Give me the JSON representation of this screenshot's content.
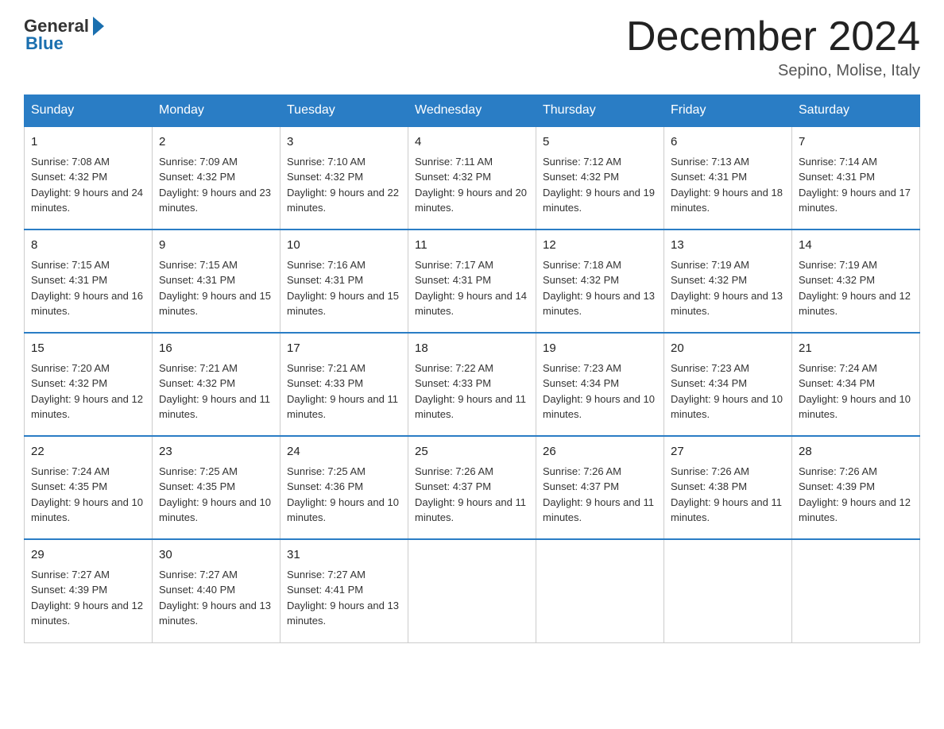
{
  "header": {
    "title": "December 2024",
    "location": "Sepino, Molise, Italy",
    "logo_general": "General",
    "logo_blue": "Blue"
  },
  "weekdays": [
    "Sunday",
    "Monday",
    "Tuesday",
    "Wednesday",
    "Thursday",
    "Friday",
    "Saturday"
  ],
  "weeks": [
    [
      {
        "day": "1",
        "sunrise": "7:08 AM",
        "sunset": "4:32 PM",
        "daylight": "9 hours and 24 minutes."
      },
      {
        "day": "2",
        "sunrise": "7:09 AM",
        "sunset": "4:32 PM",
        "daylight": "9 hours and 23 minutes."
      },
      {
        "day": "3",
        "sunrise": "7:10 AM",
        "sunset": "4:32 PM",
        "daylight": "9 hours and 22 minutes."
      },
      {
        "day": "4",
        "sunrise": "7:11 AM",
        "sunset": "4:32 PM",
        "daylight": "9 hours and 20 minutes."
      },
      {
        "day": "5",
        "sunrise": "7:12 AM",
        "sunset": "4:32 PM",
        "daylight": "9 hours and 19 minutes."
      },
      {
        "day": "6",
        "sunrise": "7:13 AM",
        "sunset": "4:31 PM",
        "daylight": "9 hours and 18 minutes."
      },
      {
        "day": "7",
        "sunrise": "7:14 AM",
        "sunset": "4:31 PM",
        "daylight": "9 hours and 17 minutes."
      }
    ],
    [
      {
        "day": "8",
        "sunrise": "7:15 AM",
        "sunset": "4:31 PM",
        "daylight": "9 hours and 16 minutes."
      },
      {
        "day": "9",
        "sunrise": "7:15 AM",
        "sunset": "4:31 PM",
        "daylight": "9 hours and 15 minutes."
      },
      {
        "day": "10",
        "sunrise": "7:16 AM",
        "sunset": "4:31 PM",
        "daylight": "9 hours and 15 minutes."
      },
      {
        "day": "11",
        "sunrise": "7:17 AM",
        "sunset": "4:31 PM",
        "daylight": "9 hours and 14 minutes."
      },
      {
        "day": "12",
        "sunrise": "7:18 AM",
        "sunset": "4:32 PM",
        "daylight": "9 hours and 13 minutes."
      },
      {
        "day": "13",
        "sunrise": "7:19 AM",
        "sunset": "4:32 PM",
        "daylight": "9 hours and 13 minutes."
      },
      {
        "day": "14",
        "sunrise": "7:19 AM",
        "sunset": "4:32 PM",
        "daylight": "9 hours and 12 minutes."
      }
    ],
    [
      {
        "day": "15",
        "sunrise": "7:20 AM",
        "sunset": "4:32 PM",
        "daylight": "9 hours and 12 minutes."
      },
      {
        "day": "16",
        "sunrise": "7:21 AM",
        "sunset": "4:32 PM",
        "daylight": "9 hours and 11 minutes."
      },
      {
        "day": "17",
        "sunrise": "7:21 AM",
        "sunset": "4:33 PM",
        "daylight": "9 hours and 11 minutes."
      },
      {
        "day": "18",
        "sunrise": "7:22 AM",
        "sunset": "4:33 PM",
        "daylight": "9 hours and 11 minutes."
      },
      {
        "day": "19",
        "sunrise": "7:23 AM",
        "sunset": "4:34 PM",
        "daylight": "9 hours and 10 minutes."
      },
      {
        "day": "20",
        "sunrise": "7:23 AM",
        "sunset": "4:34 PM",
        "daylight": "9 hours and 10 minutes."
      },
      {
        "day": "21",
        "sunrise": "7:24 AM",
        "sunset": "4:34 PM",
        "daylight": "9 hours and 10 minutes."
      }
    ],
    [
      {
        "day": "22",
        "sunrise": "7:24 AM",
        "sunset": "4:35 PM",
        "daylight": "9 hours and 10 minutes."
      },
      {
        "day": "23",
        "sunrise": "7:25 AM",
        "sunset": "4:35 PM",
        "daylight": "9 hours and 10 minutes."
      },
      {
        "day": "24",
        "sunrise": "7:25 AM",
        "sunset": "4:36 PM",
        "daylight": "9 hours and 10 minutes."
      },
      {
        "day": "25",
        "sunrise": "7:26 AM",
        "sunset": "4:37 PM",
        "daylight": "9 hours and 11 minutes."
      },
      {
        "day": "26",
        "sunrise": "7:26 AM",
        "sunset": "4:37 PM",
        "daylight": "9 hours and 11 minutes."
      },
      {
        "day": "27",
        "sunrise": "7:26 AM",
        "sunset": "4:38 PM",
        "daylight": "9 hours and 11 minutes."
      },
      {
        "day": "28",
        "sunrise": "7:26 AM",
        "sunset": "4:39 PM",
        "daylight": "9 hours and 12 minutes."
      }
    ],
    [
      {
        "day": "29",
        "sunrise": "7:27 AM",
        "sunset": "4:39 PM",
        "daylight": "9 hours and 12 minutes."
      },
      {
        "day": "30",
        "sunrise": "7:27 AM",
        "sunset": "4:40 PM",
        "daylight": "9 hours and 13 minutes."
      },
      {
        "day": "31",
        "sunrise": "7:27 AM",
        "sunset": "4:41 PM",
        "daylight": "9 hours and 13 minutes."
      },
      null,
      null,
      null,
      null
    ]
  ]
}
